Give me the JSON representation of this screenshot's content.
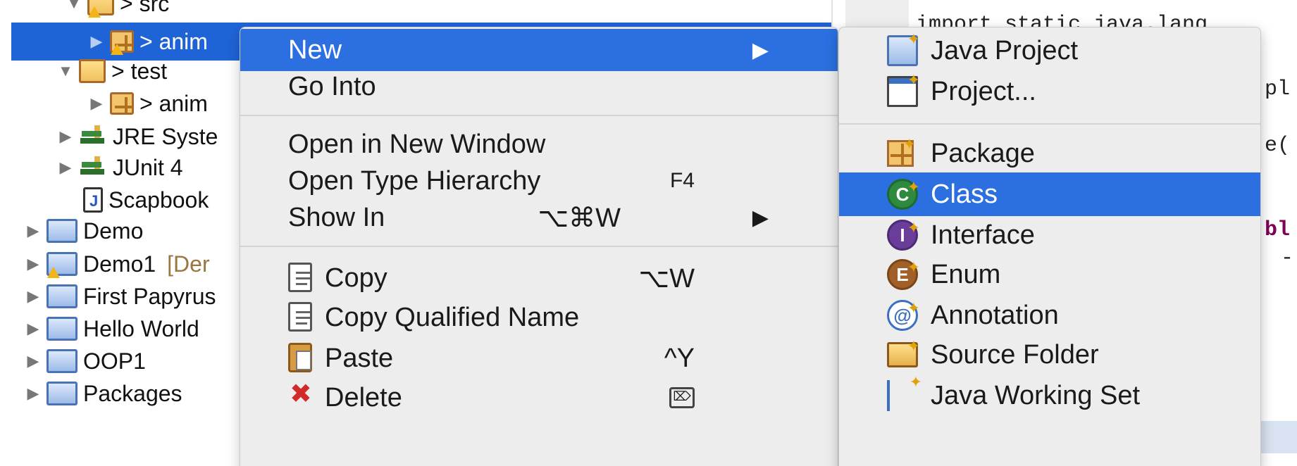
{
  "tree": {
    "items": [
      {
        "label": "> src",
        "decoration": ""
      },
      {
        "label": "> anim",
        "decoration": ""
      },
      {
        "label": "> test",
        "decoration": ""
      },
      {
        "label": "> anim",
        "decoration": ""
      },
      {
        "label": "JRE Syste",
        "decoration": ""
      },
      {
        "label": "JUnit 4",
        "decoration": ""
      },
      {
        "label": "Scapbook",
        "decoration": ""
      },
      {
        "label": "Demo",
        "decoration": ""
      },
      {
        "label": "Demo1",
        "decoration": "[Der"
      },
      {
        "label": "First Papyrus",
        "decoration": ""
      },
      {
        "label": "Hello World",
        "decoration": ""
      },
      {
        "label": "OOP1",
        "decoration": ""
      },
      {
        "label": "Packages",
        "decoration": ""
      }
    ]
  },
  "editor": {
    "code_fragments": [
      "import static java.lang",
      "pl",
      "e(",
      "bl",
      "-"
    ]
  },
  "context_menu": {
    "new": {
      "label": "New",
      "submenu_arrow": "▶"
    },
    "go_into": {
      "label": "Go Into"
    },
    "open_new_window": {
      "label": "Open in New Window"
    },
    "open_type_hierarchy": {
      "label": "Open Type Hierarchy",
      "shortcut": "F4"
    },
    "show_in": {
      "label": "Show In",
      "shortcut": "⌥⌘W",
      "submenu_arrow": "▶"
    },
    "copy": {
      "label": "Copy",
      "shortcut": "⌥W"
    },
    "copy_qualified_name": {
      "label": "Copy Qualified Name"
    },
    "paste": {
      "label": "Paste",
      "shortcut": "^Y"
    },
    "delete": {
      "label": "Delete"
    }
  },
  "new_submenu": {
    "items": [
      {
        "label": "Java Project",
        "icon": "java-project-icon"
      },
      {
        "label": "Project...",
        "icon": "project-icon"
      },
      {
        "label": "Package",
        "icon": "package-icon"
      },
      {
        "label": "Class",
        "icon": "class-icon"
      },
      {
        "label": "Interface",
        "icon": "interface-icon"
      },
      {
        "label": "Enum",
        "icon": "enum-icon"
      },
      {
        "label": "Annotation",
        "icon": "annotation-icon"
      },
      {
        "label": "Source Folder",
        "icon": "source-folder-icon"
      },
      {
        "label": "Java Working Set",
        "icon": "working-set-icon"
      }
    ],
    "selected": "Class"
  },
  "colors": {
    "selection": "#2b6fe0",
    "tree_selection": "#1f64d6",
    "menu_bg": "#ededed",
    "keyword": "#7f0055"
  }
}
